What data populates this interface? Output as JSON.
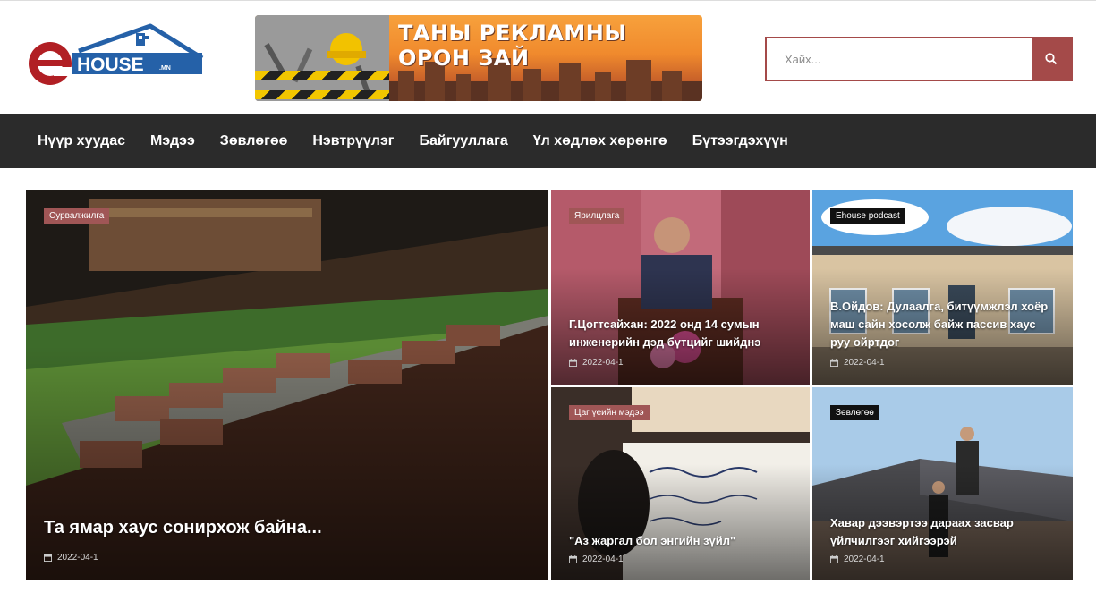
{
  "logo": {
    "letter": "e",
    "word": "HOUSE",
    "suffix": ".MN"
  },
  "banner": {
    "text": "ТАНЫ РЕКЛАМНЫ ОРОН ЗАЙ"
  },
  "search": {
    "placeholder": "Хайх..."
  },
  "nav": {
    "items": [
      {
        "label": "Нүүр хуудас"
      },
      {
        "label": "Мэдээ"
      },
      {
        "label": "Зөвлөгөө"
      },
      {
        "label": "Нэвтрүүлэг"
      },
      {
        "label": "Байгууллага"
      },
      {
        "label": "Үл хөдлөх хөрөнгө"
      },
      {
        "label": "Бүтээгдэхүүн"
      }
    ]
  },
  "articles": [
    {
      "category": "Сурвалжилга",
      "title": "Та ямар хаус сонирхож байна...",
      "date": "2022-04-1"
    },
    {
      "category": "Ярилцлага",
      "title": "Г.Цогтсайхан: 2022 онд 14 сумын инженерийн дэд бүтцийг шийднэ",
      "date": "2022-04-1"
    },
    {
      "category": "Ehouse podcast",
      "title": "В.Ойдов: Дулаалга, битүүмжлэл хоёр маш сайн хосолж байж пассив хаус руу ойртдог",
      "date": "2022-04-1"
    },
    {
      "category": "Цаг үеийн мэдээ",
      "title": "\"Аз жаргал бол энгийн зүйл\"",
      "date": "2022-04-1"
    },
    {
      "category": "Зөвлөгөө",
      "title": "Хавар дээвэртээ дараах засвар үйлчилгээг хийгээрэй",
      "date": "2022-04-1"
    }
  ],
  "colors": {
    "accent": "#a44a49",
    "nav_bg": "#2b2b2b",
    "logo_red": "#b11f24",
    "logo_blue": "#2561a8"
  },
  "icons": {
    "search": "search-icon",
    "date": "calendar-icon"
  }
}
